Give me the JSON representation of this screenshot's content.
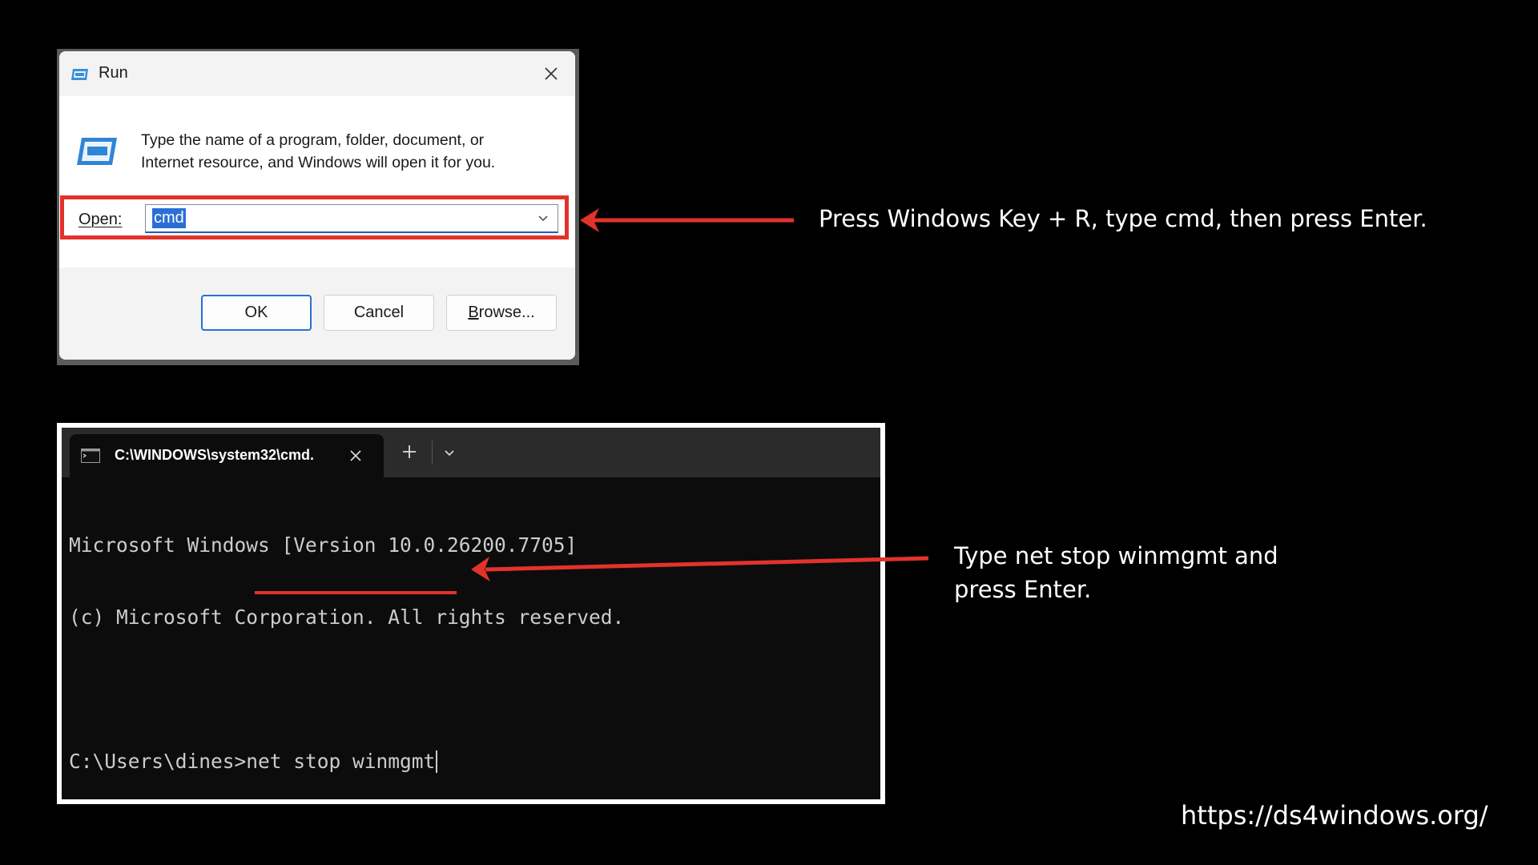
{
  "run_dialog": {
    "title": "Run",
    "description_line1": "Type the name of a program, folder, document, or",
    "description_line2": "Internet resource, and Windows will open it for you.",
    "open_label": "Open:",
    "open_value": "cmd",
    "buttons": {
      "ok": "OK",
      "cancel": "Cancel",
      "browse_underlined": "B",
      "browse_rest": "rowse..."
    },
    "highlight_color": "#e2332a",
    "icons": [
      "run-app-icon",
      "close-icon",
      "chevron-down-icon"
    ]
  },
  "terminal": {
    "tab_title": "C:\\WINDOWS\\system32\\cmd.",
    "lines": [
      "Microsoft Windows [Version 10.0.26200.7705]",
      "(c) Microsoft Corporation. All rights reserved.",
      "",
      "C:\\Users\\dines>net stop winmgmt"
    ],
    "icons": [
      "terminal-icon",
      "close-icon",
      "plus-icon",
      "chevron-down-icon"
    ]
  },
  "annotations": {
    "step1": "Press Windows Key + R, type cmd, then press Enter.",
    "step2": "Type net stop winmgmt and press Enter.",
    "arrow_color": "#e2332a"
  },
  "footer": {
    "url": "https://ds4windows.org/"
  }
}
